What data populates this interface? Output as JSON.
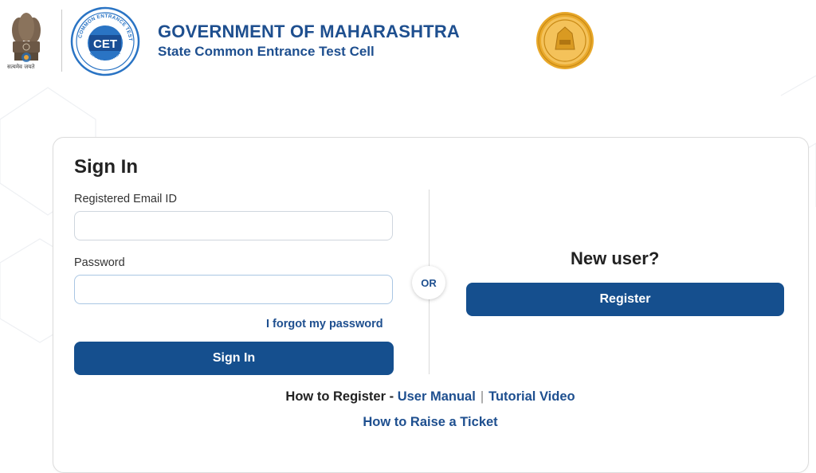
{
  "header": {
    "emblem_caption": "सत्यमेव जयते",
    "cet_logo_ring_text": "STATE COMMON ENTRANCE TEST CELL",
    "cet_logo_center": "CET",
    "cet_logo_bottom": "MAHARASHTRA",
    "title": "GOVERNMENT OF MAHARASHTRA",
    "subtitle": "State Common Entrance Test Cell"
  },
  "signin": {
    "heading": "Sign In",
    "email_label": "Registered Email ID",
    "email_value": "",
    "password_label": "Password",
    "password_value": "",
    "forgot_link": "I forgot my password",
    "button_label": "Sign In"
  },
  "divider": {
    "or_label": "OR"
  },
  "register": {
    "heading": "New user?",
    "button_label": "Register"
  },
  "help": {
    "how_to_register_label": "How to Register -",
    "user_manual_link": "User Manual",
    "tutorial_video_link": "Tutorial Video",
    "raise_ticket_link": "How to Raise a Ticket"
  },
  "colors": {
    "primary": "#154f8e",
    "link": "#1e4f8f",
    "seal_gold": "#e9a92b"
  }
}
